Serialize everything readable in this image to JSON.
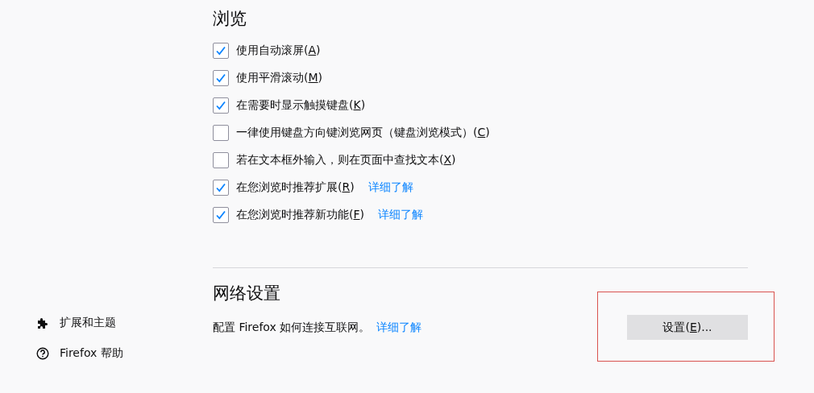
{
  "sidebar": {
    "items": [
      {
        "kind": "extensions",
        "label": "扩展和主题"
      },
      {
        "kind": "help",
        "label": "Firefox 帮助"
      }
    ]
  },
  "browsing": {
    "heading": "浏览",
    "options": [
      {
        "before": "使用自动滚屏(",
        "key": "A",
        "after": ")",
        "checked": true
      },
      {
        "before": "使用平滑滚动(",
        "key": "M",
        "after": ")",
        "checked": true
      },
      {
        "before": "在需要时显示触摸键盘(",
        "key": "K",
        "after": ")",
        "checked": true
      },
      {
        "before": "一律使用键盘方向键浏览网页（键盘浏览模式）(",
        "key": "C",
        "after": ")",
        "checked": false
      },
      {
        "before": "若在文本框外输入，则在页面中查找文本(",
        "key": "X",
        "after": ")",
        "checked": false
      },
      {
        "before": "在您浏览时推荐扩展(",
        "key": "R",
        "after": ")",
        "checked": true,
        "link": "详细了解"
      },
      {
        "before": "在您浏览时推荐新功能(",
        "key": "F",
        "after": ")",
        "checked": true,
        "link": "详细了解"
      }
    ]
  },
  "network": {
    "heading": "网络设置",
    "description": "配置 Firefox 如何连接互联网。",
    "link": "详细了解",
    "button": {
      "before": "设置(",
      "key": "E",
      "after": ")...",
      "highlighted": true
    }
  }
}
